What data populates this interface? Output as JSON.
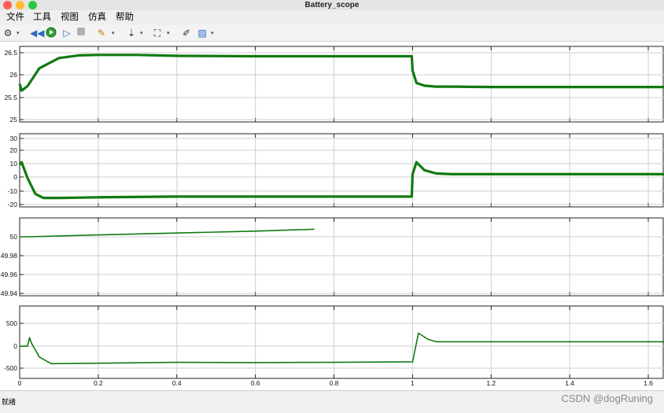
{
  "window": {
    "title": "Battery_scope"
  },
  "menu": {
    "items": [
      "文件",
      "工具",
      "视图",
      "仿真",
      "帮助"
    ]
  },
  "toolbar": {
    "icons": [
      "settings-icon",
      "step-back-icon",
      "run-icon",
      "step-forward-icon",
      "stop-icon",
      "highlight-icon",
      "cursor-icon",
      "zoom-icon",
      "style-icon",
      "properties-icon"
    ]
  },
  "chart_data": [
    {
      "type": "line",
      "ylim": [
        25,
        26.55
      ],
      "yticks": [
        "26.5",
        "26",
        "25.5",
        "25"
      ],
      "series": [
        {
          "color": "#117a11",
          "x": [
            0,
            0.005,
            0.02,
            0.05,
            0.1,
            0.15,
            0.2,
            0.3,
            0.4,
            0.6,
            0.8,
            0.998,
            1.0,
            1.01,
            1.03,
            1.06,
            1.1,
            1.2,
            1.4,
            1.6,
            1.64
          ],
          "values": [
            25.8,
            25.65,
            25.75,
            26.15,
            26.38,
            26.44,
            26.45,
            26.45,
            26.43,
            26.42,
            26.42,
            26.42,
            26.1,
            25.82,
            25.76,
            25.74,
            25.74,
            25.73,
            25.73,
            25.73,
            25.73
          ]
        }
      ]
    },
    {
      "type": "line",
      "ylim": [
        -22,
        33
      ],
      "yticks": [
        "30",
        "20",
        "10",
        "0",
        "-10",
        "-20"
      ],
      "series": [
        {
          "color": "#117a11",
          "x": [
            0,
            0.005,
            0.02,
            0.04,
            0.06,
            0.1,
            0.2,
            0.4,
            0.6,
            0.8,
            0.998,
            1.0,
            1.01,
            1.03,
            1.06,
            1.1,
            1.2,
            1.4,
            1.6,
            1.64
          ],
          "values": [
            10,
            12,
            0,
            -12,
            -15,
            -15,
            -14.5,
            -14,
            -14,
            -14,
            -14,
            3,
            12,
            6,
            3.5,
            3,
            3,
            3,
            3,
            3
          ]
        }
      ]
    },
    {
      "type": "line",
      "ylim": [
        49.935,
        50.008
      ],
      "yticks": [
        "50",
        "49.98",
        "49.96",
        "49.94"
      ],
      "series": [
        {
          "color": "#117a11",
          "x": [
            0,
            0.02,
            0.2,
            0.4,
            0.6,
            0.75
          ],
          "values": [
            50.0,
            50.0,
            50.002,
            50.004,
            50.006,
            50.008
          ]
        }
      ]
    },
    {
      "type": "line",
      "ylim": [
        -610,
        960
      ],
      "yticks": [
        "500",
        "0",
        "-500"
      ],
      "series": [
        {
          "color": "#117a11",
          "x": [
            0,
            0.02,
            0.025,
            0.03,
            0.05,
            0.08,
            0.2,
            0.4,
            0.6,
            0.8,
            1.0,
            1.015,
            1.04,
            1.06,
            1.1,
            1.3,
            1.64
          ],
          "values": [
            -10,
            -10,
            180,
            60,
            -250,
            -400,
            -390,
            -370,
            -375,
            -370,
            -360,
            280,
            140,
            90,
            90,
            90,
            90
          ]
        }
      ]
    }
  ],
  "xaxis": {
    "ticks": [
      "0",
      "0.2",
      "0.4",
      "0.6",
      "0.8",
      "1",
      "1.2",
      "1.4",
      "1.6"
    ],
    "xlim": [
      0,
      1.64
    ]
  },
  "status": {
    "text": "就绪"
  },
  "watermark": {
    "text": "CSDN @dogRuning"
  }
}
